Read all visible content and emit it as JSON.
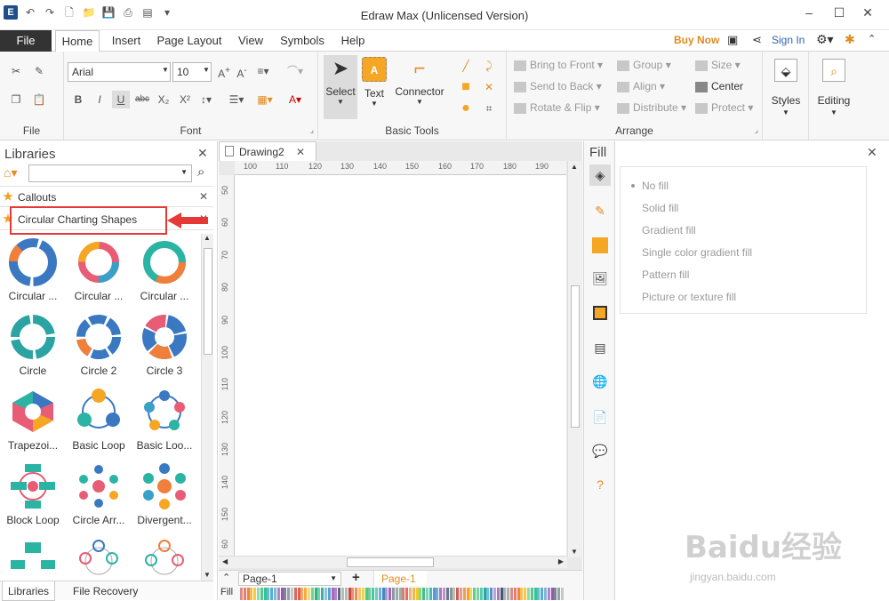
{
  "window": {
    "title": "Edraw Max (Unlicensed Version)"
  },
  "menu": {
    "file": "File",
    "tabs": [
      "Home",
      "Insert",
      "Page Layout",
      "View",
      "Symbols",
      "Help"
    ],
    "buy_now": "Buy Now",
    "sign_in": "Sign In"
  },
  "ribbon": {
    "file_group": "File",
    "font_group": "Font",
    "font_name": "Arial",
    "font_size": "10",
    "basic_tools_group": "Basic Tools",
    "select": "Select",
    "text": "Text",
    "connector": "Connector",
    "arrange_group": "Arrange",
    "bring_to_front": "Bring to Front",
    "send_to_back": "Send to Back",
    "rotate_flip": "Rotate & Flip",
    "group": "Group",
    "align": "Align",
    "distribute": "Distribute",
    "size": "Size",
    "center": "Center",
    "protect": "Protect",
    "styles": "Styles",
    "editing": "Editing"
  },
  "libraries": {
    "title": "Libraries",
    "search_placeholder": "",
    "categories": [
      "Callouts",
      "Circular Charting Shapes"
    ],
    "shapes": [
      "Circular ...",
      "Circular ...",
      "Circular ...",
      "Circle",
      "Circle 2",
      "Circle 3",
      "Trapezoi...",
      "Basic Loop",
      "Basic Loo...",
      "Block Loop",
      "Circle Arr...",
      "Divergent..."
    ],
    "bottom_tabs": [
      "Libraries",
      "File Recovery"
    ]
  },
  "document": {
    "tab": "Drawing2",
    "ruler_h": [
      "100",
      "110",
      "120",
      "130",
      "140",
      "150",
      "160",
      "170",
      "180",
      "190"
    ],
    "ruler_v": [
      "50",
      "60",
      "70",
      "80",
      "90",
      "100",
      "110",
      "120",
      "130",
      "140",
      "150",
      "60"
    ],
    "page_name": "Page-1",
    "page_tab": "Page-1",
    "fill_label": "Fill"
  },
  "fill": {
    "title": "Fill",
    "options": [
      "No fill",
      "Solid fill",
      "Gradient fill",
      "Single color gradient fill",
      "Pattern fill",
      "Picture or texture fill"
    ]
  },
  "watermark": {
    "text": "Baidu经验",
    "url": "jingyan.baidu.com"
  },
  "colors": {
    "accent": "#e38a1f",
    "link": "#2f64b3",
    "highlight": "#e53935",
    "file_tab": "#333333"
  }
}
